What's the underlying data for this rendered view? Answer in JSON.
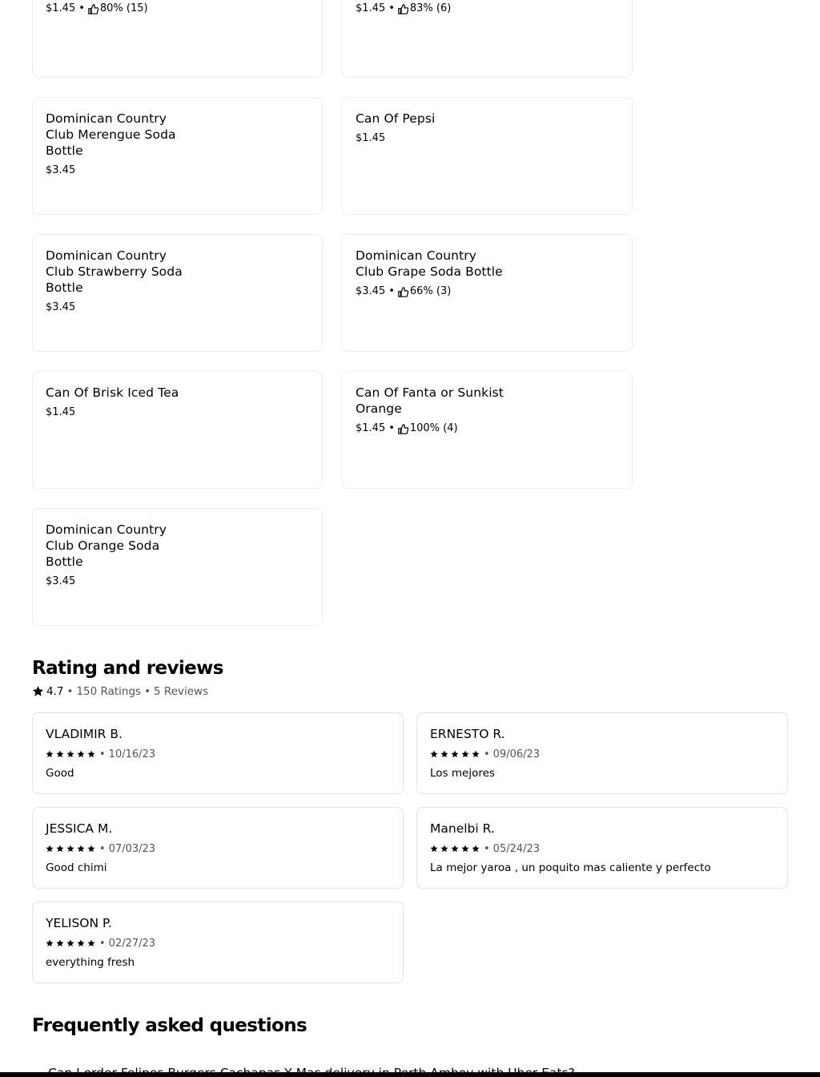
{
  "menu_items": [
    {
      "name": "",
      "price": "$1.45",
      "rating": "80% (15)"
    },
    {
      "name": "",
      "price": "$1.45",
      "rating": "83% (6)"
    },
    {
      "name": "Dominican Country Club Merengue Soda Bottle",
      "price": "$3.45",
      "rating": ""
    },
    {
      "name": "Can Of Pepsi",
      "price": "$1.45",
      "rating": ""
    },
    {
      "name": "Dominican Country Club Strawberry Soda Bottle",
      "price": "$3.45",
      "rating": ""
    },
    {
      "name": "Dominican Country Club Grape Soda Bottle",
      "price": "$3.45",
      "rating": "66% (3)"
    },
    {
      "name": "Can Of Brisk Iced Tea",
      "price": "$1.45",
      "rating": ""
    },
    {
      "name": "Can Of Fanta or Sunkist Orange",
      "price": "$1.45",
      "rating": "100% (4)"
    },
    {
      "name": "Dominican Country Club Orange Soda Bottle",
      "price": "$3.45",
      "rating": ""
    }
  ],
  "reviews_section": {
    "title": "Rating and reviews",
    "rating": "4.7",
    "ratings_count": "150 Ratings",
    "reviews_count": "5 Reviews",
    "separator": "•",
    "reviews": [
      {
        "author": "VLADIMIR B.",
        "stars": 5,
        "date": "10/16/23",
        "text": "Good"
      },
      {
        "author": "ERNESTO R.",
        "stars": 5,
        "date": "09/06/23",
        "text": "Los mejores"
      },
      {
        "author": "JESSICA M.",
        "stars": 5,
        "date": "07/03/23",
        "text": "Good chimi"
      },
      {
        "author": "Manelbi R.",
        "stars": 5,
        "date": "05/24/23",
        "text": "La mejor yaroa , un poquito mas caliente y perfecto"
      },
      {
        "author": "YELISON P.",
        "stars": 5,
        "date": "02/27/23",
        "text": "everything fresh"
      }
    ]
  },
  "faq": {
    "title": "Frequently asked questions",
    "questions": [
      "Can I order Felipes Burgers Cachapas Y Mas delivery in Perth Amboy with Uber Eats?"
    ]
  },
  "icons": {
    "rating_icon": "thumbs-up-icon",
    "star_icon": "star-icon",
    "faq_icon": "chevron-down-icon"
  }
}
